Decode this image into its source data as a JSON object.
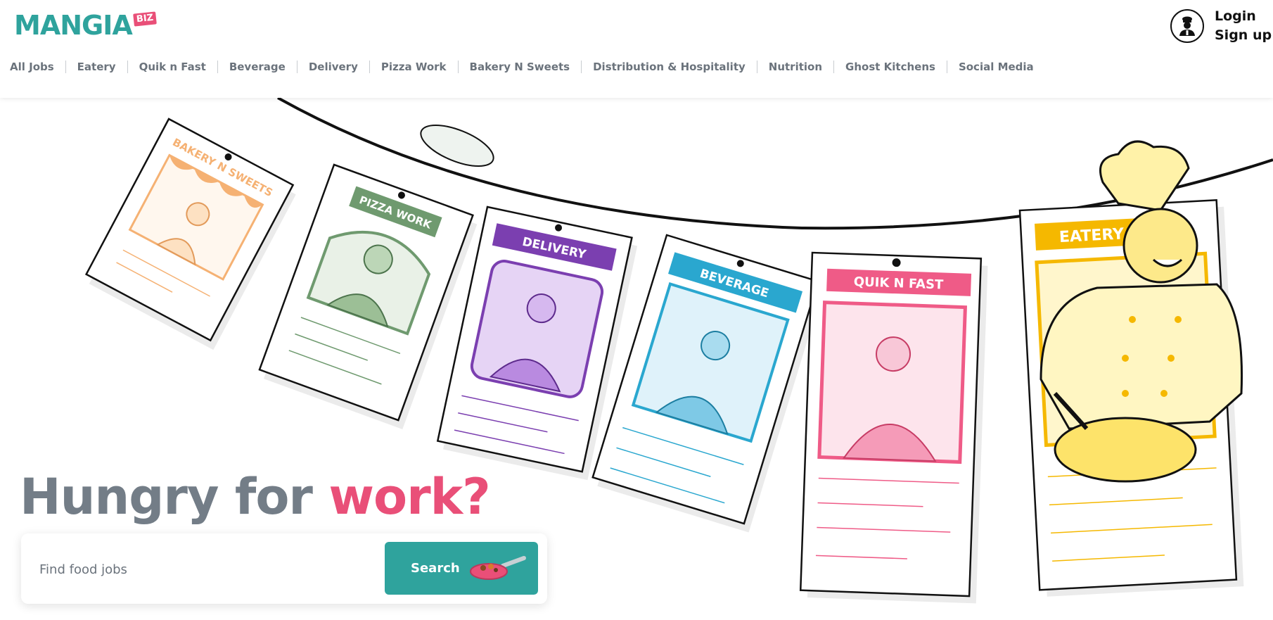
{
  "brand": {
    "name": "MANGIA",
    "badge": "BIZ"
  },
  "nav": {
    "items": [
      {
        "label": "All Jobs"
      },
      {
        "label": "Eatery"
      },
      {
        "label": "Quik n Fast"
      },
      {
        "label": "Beverage"
      },
      {
        "label": "Delivery"
      },
      {
        "label": "Pizza Work"
      },
      {
        "label": "Bakery N Sweets"
      },
      {
        "label": "Distribution & Hospitality"
      },
      {
        "label": "Nutrition"
      },
      {
        "label": "Ghost Kitchens"
      },
      {
        "label": "Social Media"
      }
    ]
  },
  "account": {
    "login": "Login",
    "signup": "Sign up",
    "icon": "chef-avatar-icon"
  },
  "hero": {
    "headline_main": "Hungry for ",
    "headline_accent": "work?",
    "cards": [
      {
        "label": "BAKERY N SWEETS",
        "color": "#f5b173"
      },
      {
        "label": "PIZZA WORK",
        "color": "#6f9a6f"
      },
      {
        "label": "DELIVERY",
        "color": "#7b3fb0"
      },
      {
        "label": "BEVERAGE",
        "color": "#2aa7cf"
      },
      {
        "label": "QUIK N FAST",
        "color": "#ef5b87"
      },
      {
        "label": "EATERY",
        "color": "#f5b800"
      }
    ]
  },
  "search": {
    "placeholder": "Find food jobs",
    "button_label": "Search",
    "icon": "frying-pan-icon"
  },
  "colors": {
    "teal": "#2fa39d",
    "pink": "#e94f78",
    "gray": "#737d87"
  }
}
